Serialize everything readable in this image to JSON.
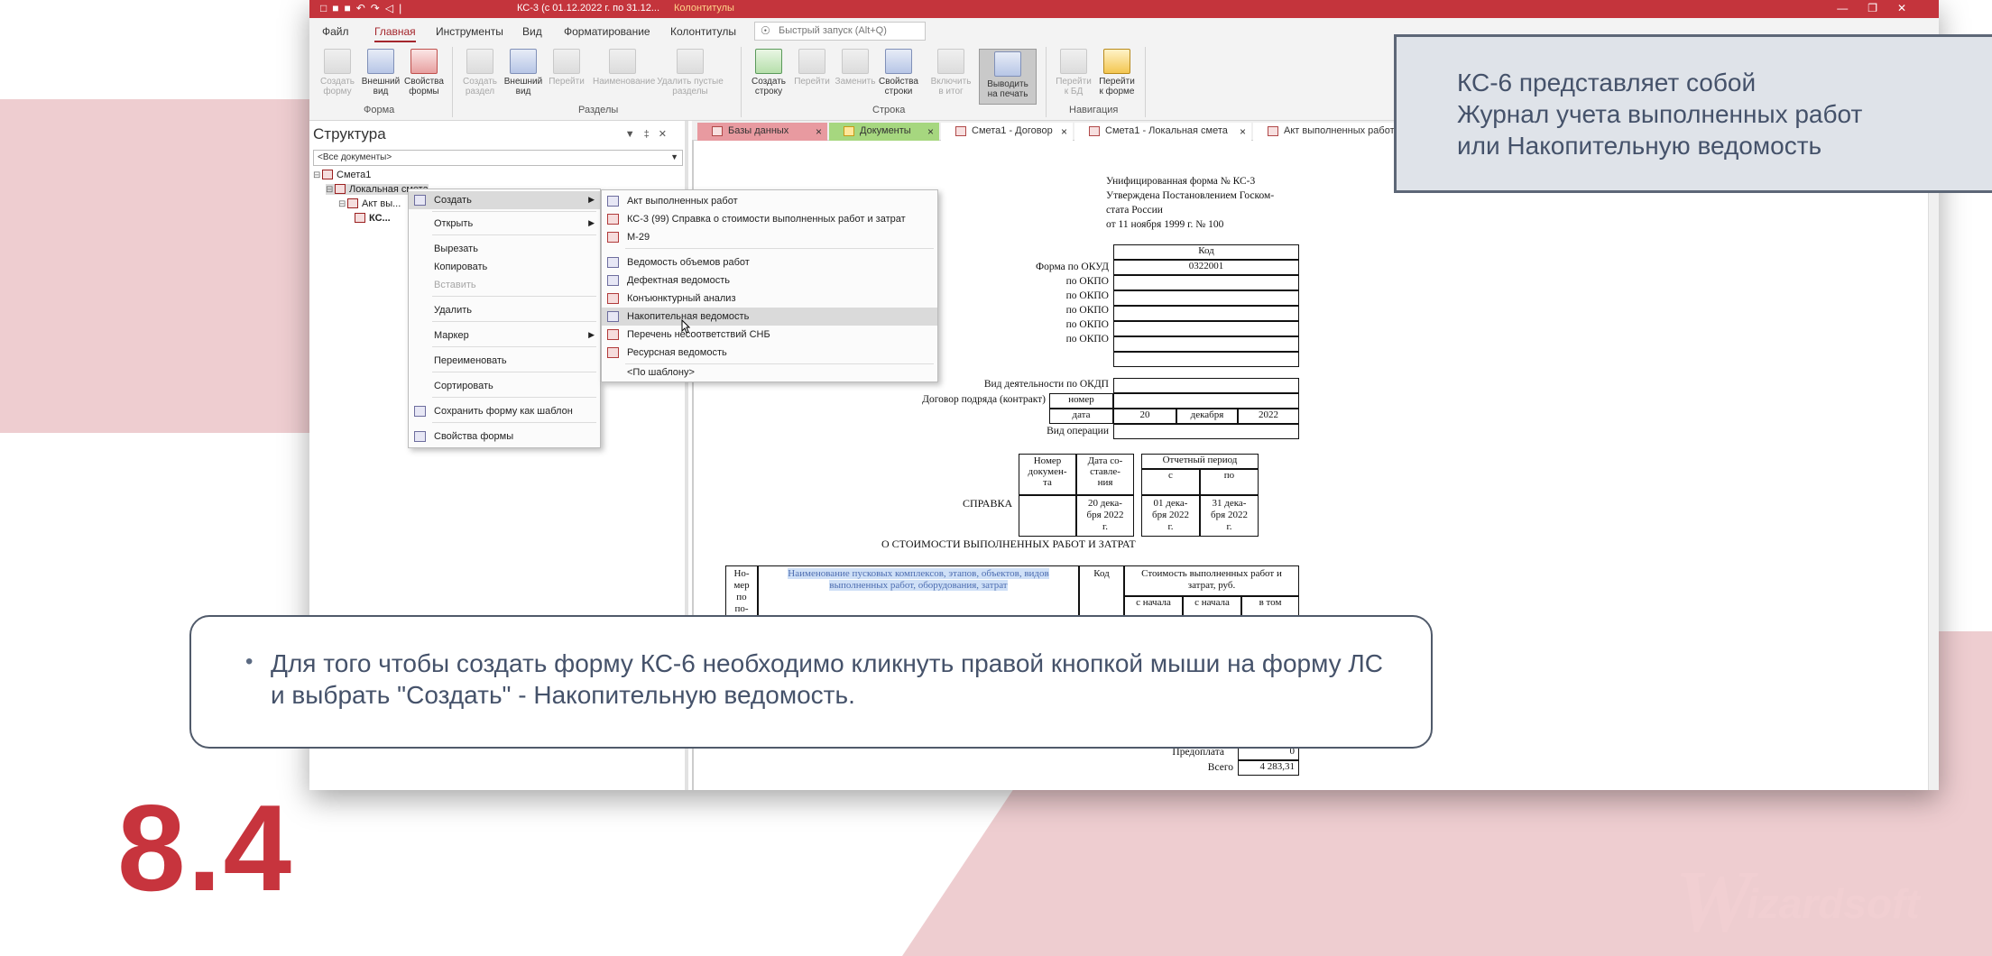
{
  "window": {
    "title": "КС-3 (с 01.12.2022 г. по 31.12...",
    "context_tab": "Колонтитулы"
  },
  "menu": {
    "items": [
      "Файл",
      "Главная",
      "Инструменты",
      "Вид",
      "Форматирование",
      "Колонтитулы"
    ],
    "active": "Главная",
    "quick_launch_placeholder": "Быстрый запуск (Alt+Q)"
  },
  "ribbon": {
    "buttons": [
      {
        "label": "Создать\nформу",
        "enabled": false
      },
      {
        "label": "Внешний\nвид",
        "enabled": true
      },
      {
        "label": "Свойства\nформы",
        "enabled": true
      },
      {
        "label": "Создать\nраздел",
        "enabled": false
      },
      {
        "label": "Внешний\nвид",
        "enabled": true
      },
      {
        "label": "Перейти",
        "enabled": false
      },
      {
        "label": "Наименование",
        "enabled": false
      },
      {
        "label": "Удалить пустые\nразделы",
        "enabled": false
      },
      {
        "label": "Создать\nстроку",
        "enabled": true
      },
      {
        "label": "Перейти",
        "enabled": false
      },
      {
        "label": "Заменить",
        "enabled": false
      },
      {
        "label": "Свойства\nстроки",
        "enabled": true
      },
      {
        "label": "Включить\nв итог",
        "enabled": false
      },
      {
        "label": "Выводить\nна печать",
        "enabled": true,
        "pressed": true
      },
      {
        "label": "Перейти\nк БД",
        "enabled": false
      },
      {
        "label": "Перейти\nк форме",
        "enabled": true
      }
    ],
    "groups": [
      "Форма",
      "Разделы",
      "Строка",
      "Навигация"
    ]
  },
  "structure": {
    "title": "Структура",
    "filter_value": "<Все документы>",
    "tree": [
      "Смета1",
      "Локальная смета",
      "Акт вы...",
      "КС..."
    ]
  },
  "doc_tabs": [
    "Базы данных",
    "Документы",
    "Смета1 - Договор",
    "Смета1 - Локальная смета",
    "Акт выполненных работ"
  ],
  "context_menu": {
    "items": [
      "Создать",
      "Открыть",
      "Вырезать",
      "Копировать",
      "Вставить",
      "Удалить",
      "Маркер",
      "Переименовать",
      "Сортировать",
      "Сохранить форму как шаблон",
      "Свойства формы"
    ]
  },
  "submenu": {
    "items": [
      "Акт выполненных работ",
      "КС-3 (99) Справка о стоимости выполненных работ и затрат",
      "М-29",
      "Ведомость объемов работ",
      "Дефектная ведомость",
      "Конъюнктурный анализ",
      "Накопительная ведомость",
      "Перечень несоответствий СНБ",
      "Ресурсная ведомость",
      "<По шаблону>"
    ],
    "highlighted": "Накопительная ведомость"
  },
  "form": {
    "header_lines": [
      "Унифицированная форма № КС-3",
      "Утверждена Постановлением Госком-",
      "стата России",
      "от 11 ноября 1999 г. № 100"
    ],
    "code_header": "Код",
    "rows": [
      {
        "label": "Форма по ОКУД",
        "value": "0322001"
      },
      {
        "label": "по ОКПО",
        "value": ""
      },
      {
        "label": "по ОКПО",
        "value": ""
      },
      {
        "label": "по ОКПО",
        "value": ""
      },
      {
        "label": "по ОКПО",
        "value": ""
      },
      {
        "label": "по ОКПО",
        "value": ""
      }
    ],
    "okdp_label": "Вид деятельности по ОКДП",
    "contract_label": "Договор подряда (контракт)",
    "number_label": "номер",
    "date_label": "дата",
    "date_day": "20",
    "date_month": "декабря",
    "date_year": "2022",
    "operation_label": "Вид операции",
    "doc_number_header": "Номер\nдокумен-\nта",
    "doc_date_header": "Дата со-\nставле-\nния",
    "period_header": "Отчетный период",
    "period_from": "с",
    "period_to": "по",
    "spravka": "СПРАВКА",
    "doc_date": "20 дека-\nбря 2022\nг.",
    "period_from_value": "01 дека-\nбря 2022\nг.",
    "period_to_value": "31 дека-\nбря 2022\nг.",
    "subtitle": "О СТОИМОСТИ ВЫПОЛНЕННЫХ РАБОТ И ЗАТРАТ",
    "table_col1": "Но-\nмер\nпо\nпо-",
    "table_col2": "Наименование пусковых комплексов, этапов, объектов, видов\nвыполненных работ, оборудования, затрат",
    "table_col3": "Код",
    "table_col4": "Стоимость выполненных работ и\nзатрат, руб.",
    "table_sub1": "с начала",
    "table_sub2": "с начала",
    "table_sub3": "в том",
    "prepay_label": "Предоплата",
    "prepay_value": "0",
    "total_label": "Всего",
    "total_value": "4 283,31"
  },
  "callout_top": "КС-6 представляет собой\nЖурнал учета выполненных работ\nили Накопительную ведомость",
  "callout_bottom": "Для того чтобы создать форму КС-6 необходимо кликнуть правой кнопкой мыши на форму ЛС и выбрать \"Создать\" - Накопительную ведомость.",
  "slide_number": "8.4",
  "brand": "wizardsoft",
  "colors": {
    "accent": "#c7343d",
    "titlebar": "#c4343c",
    "callout_text": "#45526a"
  }
}
